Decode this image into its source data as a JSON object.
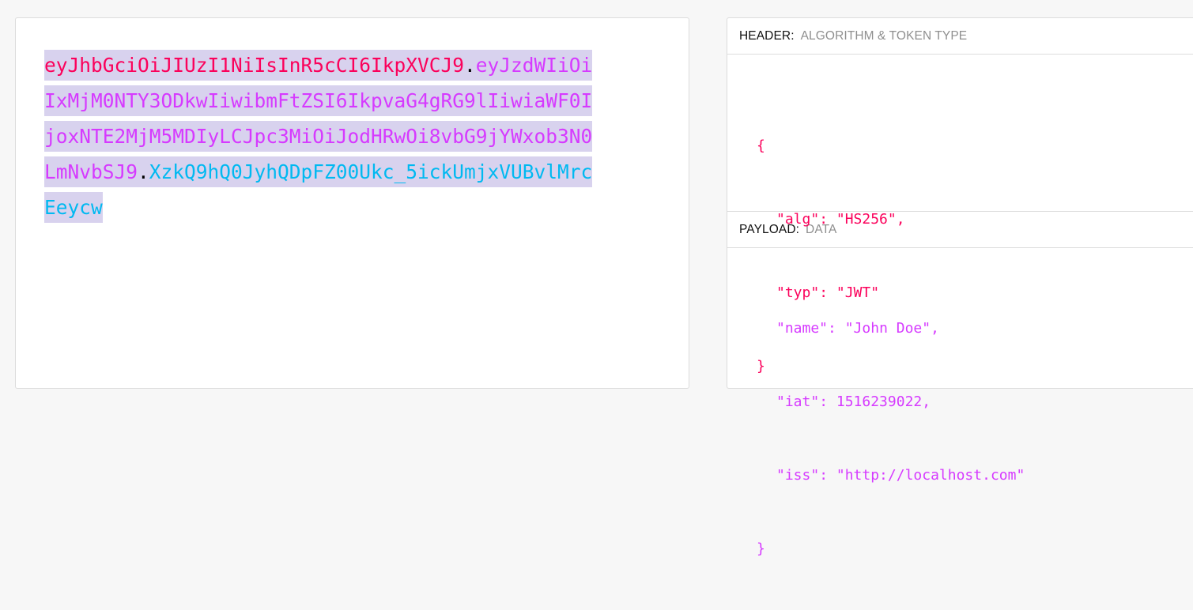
{
  "encoded": {
    "header_part": "eyJhbGciOiJIUzI1NiIsInR5cCI6IkpXVCJ9",
    "payload_part": "eyJzdWIiOiIxMjM0NTY3ODkwIiwibmFtZSI6IkpvaG4gRG9lIiwiaWF0IjoxNTE2MjM5MDIyLCJpc3MiOiJodHRwOi8vbG9jYWxob3N0LmNvbSJ9",
    "signature_part": "XzkQ9hQ0JyhQDpFZ00Ukc_5ickUmjxVUBvlMrcEeycw",
    "separator": "."
  },
  "header_section": {
    "label": "HEADER:",
    "sublabel": "ALGORITHM & TOKEN TYPE",
    "json": {
      "open_brace": "{",
      "lines": [
        {
          "key": "\"alg\"",
          "sep": ": ",
          "value": "\"HS256\"",
          "trail": ","
        },
        {
          "key": "\"typ\"",
          "sep": ": ",
          "value": "\"JWT\"",
          "trail": ""
        }
      ],
      "close_brace": "}"
    }
  },
  "payload_section": {
    "label": "PAYLOAD:",
    "sublabel": "DATA",
    "json": {
      "lines": [
        {
          "key": "\"name\"",
          "sep": ": ",
          "value": "\"John Doe\"",
          "trail": ","
        },
        {
          "key": "\"iat\"",
          "sep": ": ",
          "value": "1516239022",
          "trail": ","
        },
        {
          "key": "\"iss\"",
          "sep": ": ",
          "value": "\"http://localhost.com\"",
          "trail": ""
        }
      ],
      "close_brace": "}"
    }
  },
  "colors": {
    "header_red": "#fb015b",
    "payload_purple": "#d63aff",
    "signature_blue": "#00b9f1",
    "selection_bg": "#d8d2ee"
  }
}
